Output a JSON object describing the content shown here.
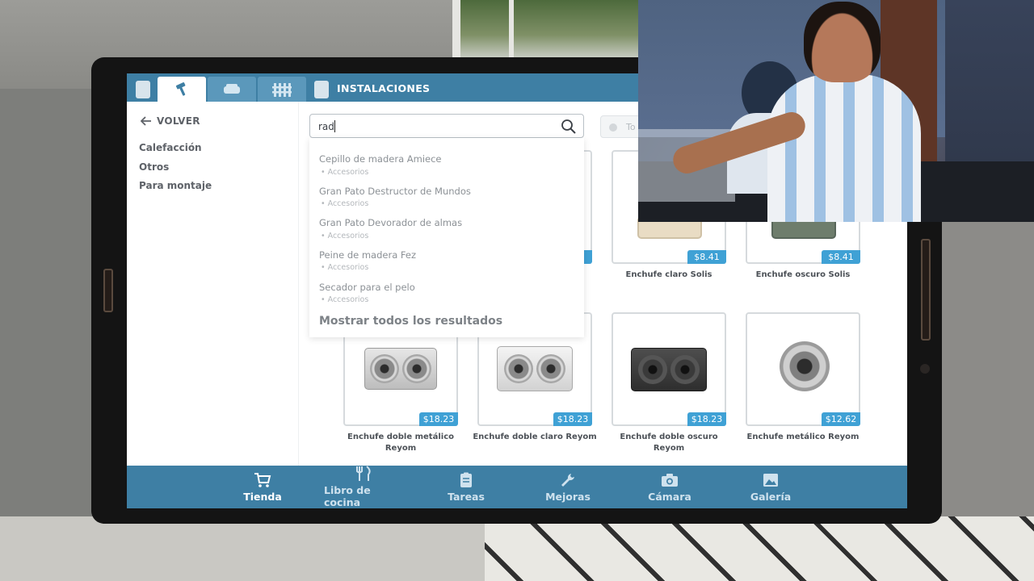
{
  "window": {
    "section_title": "INSTALACIONES"
  },
  "tabs": [
    {
      "icon": "hammer-icon",
      "label": ""
    },
    {
      "icon": "sofa-icon",
      "label": ""
    },
    {
      "icon": "fence-icon",
      "label": ""
    }
  ],
  "sidebar": {
    "back_label": "VOLVER",
    "categories": [
      "Calefacción",
      "Otros",
      "Para montaje"
    ]
  },
  "search": {
    "value": "rad",
    "icon": "search-icon"
  },
  "filter": {
    "label": "To"
  },
  "suggestions": {
    "items": [
      {
        "title": "Cepillo de madera Amiece",
        "category": "Accesorios"
      },
      {
        "title": "Gran Pato Destructor de Mundos",
        "category": "Accesorios"
      },
      {
        "title": "Gran Pato Devorador de almas",
        "category": "Accesorios"
      },
      {
        "title": "Peine de madera Fez",
        "category": "Accesorios"
      },
      {
        "title": "Secador para el pelo",
        "category": "Accesorios"
      }
    ],
    "show_all": "Mostrar todos los resultados"
  },
  "products": {
    "row1": [
      {
        "name": "",
        "price": ""
      },
      {
        "name": "",
        "price": ""
      },
      {
        "name": "Enchufe claro Solis",
        "price": "$8.41"
      },
      {
        "name": "Enchufe oscuro Solis",
        "price": "$8.41"
      }
    ],
    "row2": [
      {
        "name": "Enchufe doble metálico Reyom",
        "price": "$18.23"
      },
      {
        "name": "Enchufe doble claro Reyom",
        "price": "$18.23"
      },
      {
        "name": "Enchufe doble oscuro Reyom",
        "price": "$18.23"
      },
      {
        "name": "Enchufe metálico Reyom",
        "price": "$12.62"
      }
    ]
  },
  "bottom_nav": [
    {
      "label": "Tienda",
      "icon": "cart-icon",
      "active": true
    },
    {
      "label": "Libro de cocina",
      "icon": "cutlery-icon",
      "active": false
    },
    {
      "label": "Tareas",
      "icon": "clipboard-icon",
      "active": false
    },
    {
      "label": "Mejoras",
      "icon": "wrench-icon",
      "active": false
    },
    {
      "label": "Cámara",
      "icon": "camera-icon",
      "active": false
    },
    {
      "label": "Galería",
      "icon": "image-icon",
      "active": false
    }
  ],
  "colors": {
    "accent": "#3e7fa4",
    "price_badge": "#3fa1d5"
  }
}
